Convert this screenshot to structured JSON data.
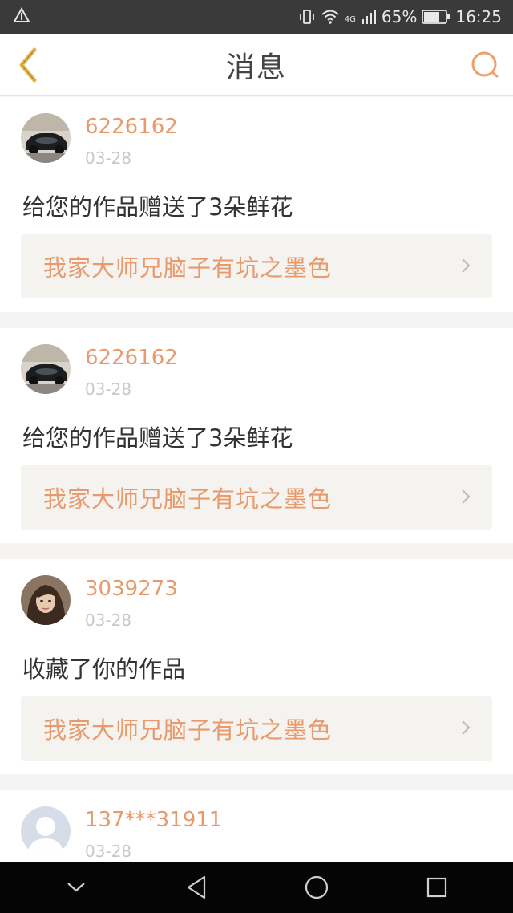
{
  "status": {
    "network": "4G",
    "battery": "65%",
    "time": "16:25"
  },
  "header": {
    "title": "消息"
  },
  "messages": [
    {
      "username": "6226162",
      "date": "03-28",
      "action": "给您的作品赠送了3朵鲜花",
      "work_title": "我家大师兄脑子有坑之墨色"
    },
    {
      "username": "6226162",
      "date": "03-28",
      "action": "给您的作品赠送了3朵鲜花",
      "work_title": "我家大师兄脑子有坑之墨色"
    },
    {
      "username": "3039273",
      "date": "03-28",
      "action": "收藏了你的作品",
      "work_title": "我家大师兄脑子有坑之墨色"
    },
    {
      "username": "137***31911",
      "date": "03-28"
    }
  ],
  "colors": {
    "accent": "#e89a6c",
    "back_icon": "#e6b84a"
  },
  "icons": {
    "back": "chevron-left-icon",
    "search": "search-icon",
    "chevron": "chevron-right-icon"
  }
}
